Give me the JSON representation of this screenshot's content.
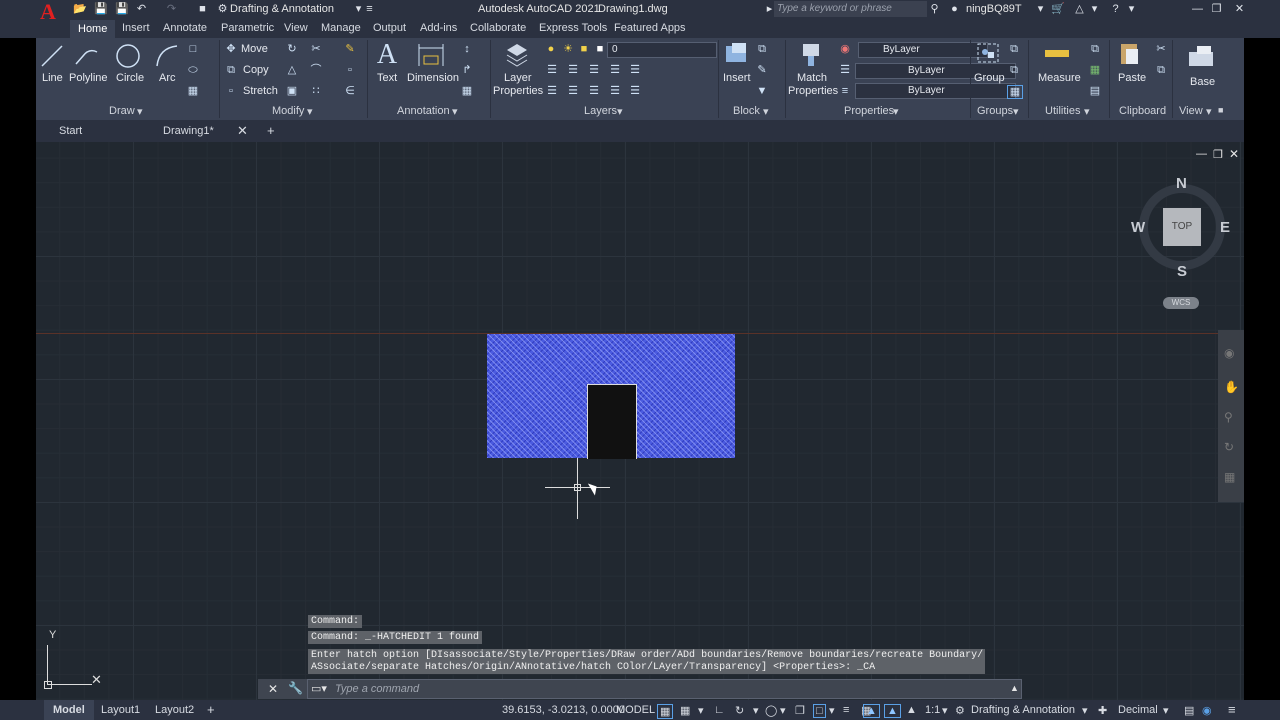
{
  "title_bar": {
    "workspace": "Drafting & Annotation",
    "app_title": "Autodesk AutoCAD 2021",
    "file_name": "Drawing1.dwg",
    "search_placeholder": "Type a keyword or phrase",
    "user": "ningBQ89T"
  },
  "ribbon_tabs": [
    "Home",
    "Insert",
    "Annotate",
    "Parametric",
    "View",
    "Manage",
    "Output",
    "Add-ins",
    "Collaborate",
    "Express Tools",
    "Featured Apps"
  ],
  "draw_panel": {
    "title": "Draw",
    "line": "Line",
    "polyline": "Polyline",
    "circle": "Circle",
    "arc": "Arc"
  },
  "modify_panel": {
    "title": "Modify",
    "move": "Move",
    "copy": "Copy",
    "stretch": "Stretch"
  },
  "annotation_panel": {
    "title": "Annotation",
    "text": "Text",
    "dimension": "Dimension"
  },
  "layers_panel": {
    "title": "Layers",
    "layer_properties_1": "Layer",
    "layer_properties_2": "Properties",
    "current_layer": "0"
  },
  "block_panel": {
    "title": "Block",
    "insert": "Insert"
  },
  "properties_panel": {
    "title": "Properties",
    "match_1": "Match",
    "match_2": "Properties",
    "color": "ByLayer",
    "linetype": "ByLayer",
    "lineweight": "ByLayer"
  },
  "groups_panel": {
    "title": "Groups",
    "group": "Group"
  },
  "utilities_panel": {
    "title": "Utilities",
    "measure": "Measure"
  },
  "clipboard_panel": {
    "title": "Clipboard",
    "paste": "Paste"
  },
  "view_panel": {
    "title": "View",
    "base": "Base"
  },
  "file_tabs": {
    "start": "Start",
    "drawing": "Drawing1*"
  },
  "viewcube": {
    "n": "N",
    "s": "S",
    "e": "E",
    "w": "W",
    "top": "TOP",
    "wcs": "WCS"
  },
  "ucs": {
    "y": "Y"
  },
  "command": {
    "line1": "Command:",
    "line2": "Command: _-HATCHEDIT 1 found",
    "line3": "Enter hatch option [DIsassociate/Style/Properties/DRaw order/ADd boundaries/Remove boundaries/recreate Boundary/",
    "line4": "ASsociate/separate Hatches/Origin/ANnotative/hatch COlor/LAyer/Transparency] <Properties>: _CA",
    "placeholder": "Type a command"
  },
  "status_bar": {
    "model_tab": "Model",
    "layout1": "Layout1",
    "layout2": "Layout2",
    "coords": "39.6153, -3.0213, 0.0000",
    "space": "MODEL",
    "scale": "1:1",
    "workspace": "Drafting & Annotation",
    "units": "Decimal"
  },
  "colors": {
    "accent": "#2b3140",
    "hatch": "#4b5be0",
    "ribbon": "#3a4254"
  }
}
